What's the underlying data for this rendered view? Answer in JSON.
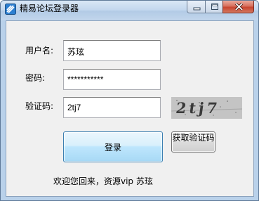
{
  "window": {
    "title": "精易论坛登录器"
  },
  "form": {
    "username_label": "用户名:",
    "username_value": "苏玹",
    "password_label": "密码:",
    "password_value": "***********",
    "captcha_label": "验证码:",
    "captcha_value": "2tj7",
    "captcha_image_text": "2tj7"
  },
  "buttons": {
    "login": "登录",
    "get_captcha": "获取验证码"
  },
  "status": {
    "welcome": "欢迎您回来，资源vip 苏玹"
  },
  "colors": {
    "title_bar": "#c4d8ee",
    "close_button": "#c84530",
    "login_button": "#bee6fd",
    "client_bg": "#f0f0f0"
  },
  "icons": {
    "app": "app-logo-icon",
    "minimize": "minimize-icon",
    "maximize": "maximize-icon",
    "close": "close-icon"
  }
}
